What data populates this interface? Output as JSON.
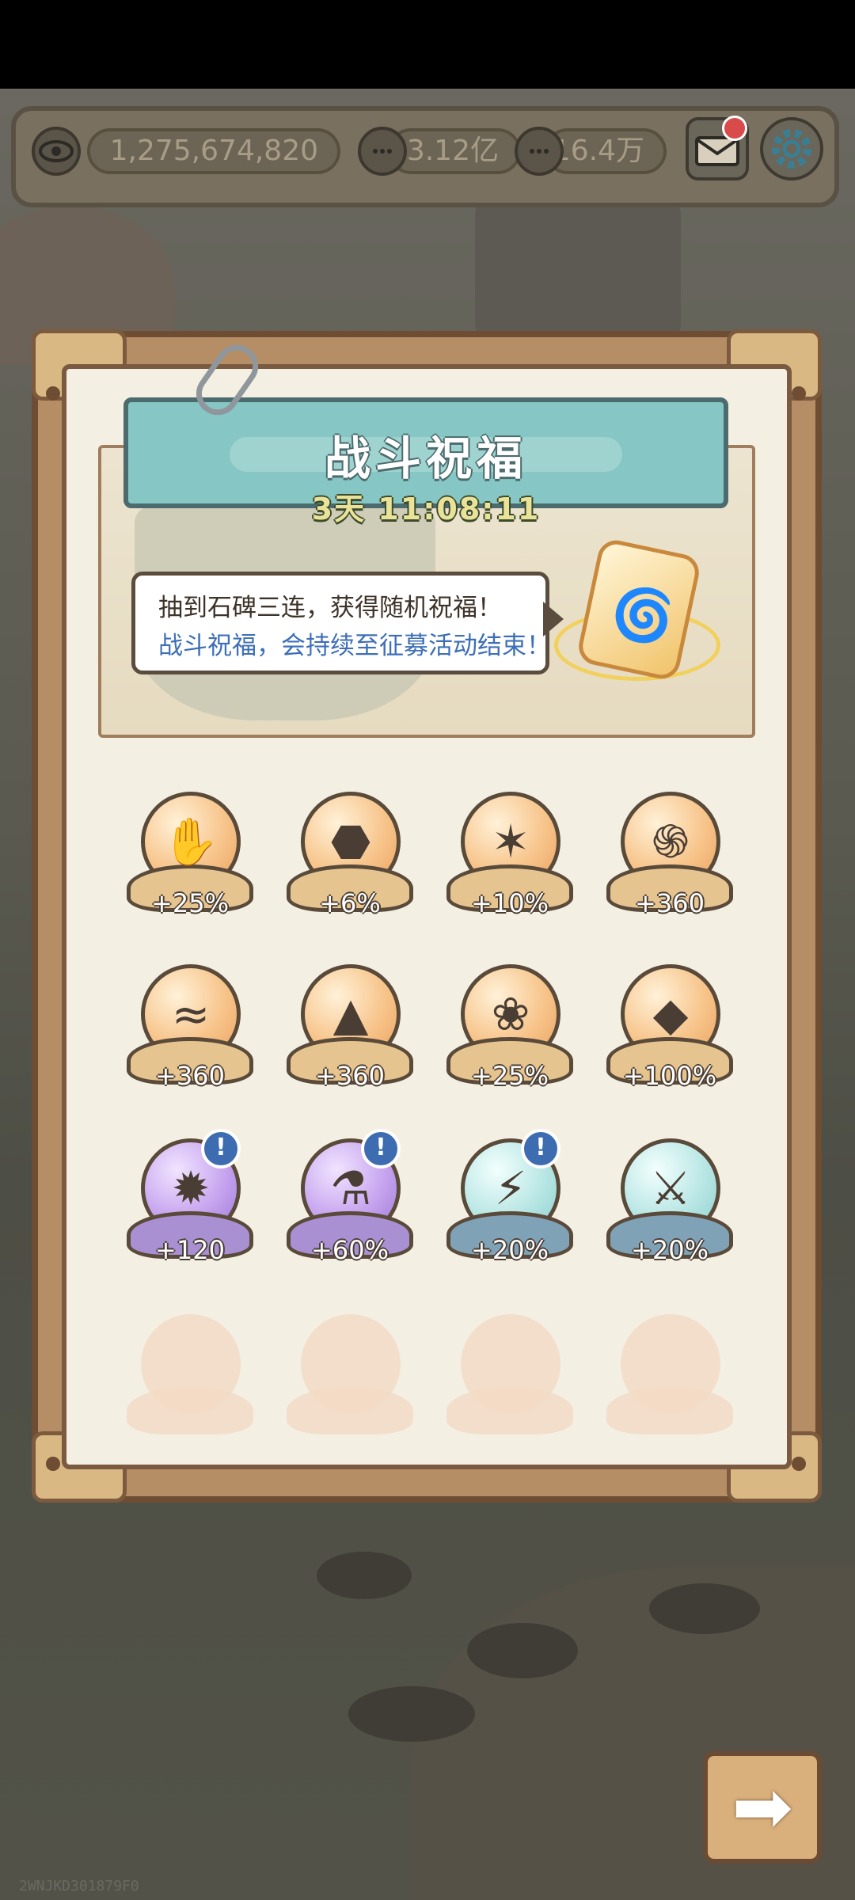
{
  "topbar": {
    "eye_count": "1,275,674,820",
    "chat_count_1": "3.12亿",
    "chat_count_2": "16.4万",
    "icons": [
      "eye-icon",
      "chat-icon",
      "chat-icon",
      "mail-icon",
      "gear-icon"
    ]
  },
  "panel": {
    "title": "战斗祝福",
    "timer": "3天 11:08:11",
    "bubble_line1": "抽到石碑三连，获得随机祝福！",
    "bubble_line2": "战斗祝福，会持续至征募活动结束！"
  },
  "orbs": [
    {
      "value": "+25%",
      "style": "gold",
      "icon": "claw-icon"
    },
    {
      "value": "+6%",
      "style": "gold",
      "icon": "turtle-shell-icon"
    },
    {
      "value": "+10%",
      "style": "gold",
      "icon": "wolf-head-icon"
    },
    {
      "value": "+360",
      "style": "gold",
      "icon": "wind-swirl-icon"
    },
    {
      "value": "+360",
      "style": "gold",
      "icon": "water-wave-icon"
    },
    {
      "value": "+360",
      "style": "gold",
      "icon": "sand-pile-icon"
    },
    {
      "value": "+25%",
      "style": "gold",
      "icon": "paw-icon"
    },
    {
      "value": "+100%",
      "style": "gold",
      "icon": "shield-icon"
    },
    {
      "value": "+120",
      "style": "purple",
      "icon": "fire-icon",
      "info": true
    },
    {
      "value": "+60%",
      "style": "purple",
      "icon": "potion-icon",
      "info": true
    },
    {
      "value": "+20%",
      "style": "teal",
      "icon": "lightning-icon",
      "info": true
    },
    {
      "value": "+20%",
      "style": "teal",
      "icon": "sword-icon"
    }
  ],
  "watermark": "2WNJKD301879F0",
  "colors": {
    "title_plate": "#86c6c4",
    "bubble_highlight": "#3d6fb7",
    "timer_text": "#e9e39a"
  }
}
